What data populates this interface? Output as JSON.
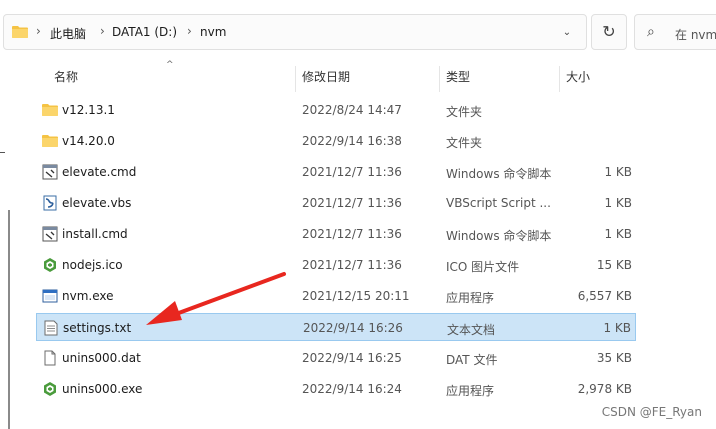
{
  "breadcrumb": [
    "此电脑",
    "DATA1 (D:)",
    "nvm"
  ],
  "search": {
    "placeholder": "在 nvm"
  },
  "columns": {
    "name": "名称",
    "date": "修改日期",
    "type": "类型",
    "size": "大小"
  },
  "files": [
    {
      "name": "v12.13.1",
      "date": "2022/8/24 14:47",
      "type": "文件夹",
      "size": "",
      "icon": "folder-icon"
    },
    {
      "name": "v14.20.0",
      "date": "2022/9/14 16:38",
      "type": "文件夹",
      "size": "",
      "icon": "folder-icon"
    },
    {
      "name": "elevate.cmd",
      "date": "2021/12/7 11:36",
      "type": "Windows 命令脚本",
      "size": "1 KB",
      "icon": "cmd-script-icon"
    },
    {
      "name": "elevate.vbs",
      "date": "2021/12/7 11:36",
      "type": "VBScript Script ...",
      "size": "1 KB",
      "icon": "vbs-script-icon"
    },
    {
      "name": "install.cmd",
      "date": "2021/12/7 11:36",
      "type": "Windows 命令脚本",
      "size": "1 KB",
      "icon": "cmd-script-icon"
    },
    {
      "name": "nodejs.ico",
      "date": "2021/12/7 11:36",
      "type": "ICO 图片文件",
      "size": "15 KB",
      "icon": "nodejs-icon"
    },
    {
      "name": "nvm.exe",
      "date": "2021/12/15 20:11",
      "type": "应用程序",
      "size": "6,557 KB",
      "icon": "exe-window-icon"
    },
    {
      "name": "settings.txt",
      "date": "2022/9/14 16:26",
      "type": "文本文档",
      "size": "1 KB",
      "icon": "text-document-icon",
      "selected": true
    },
    {
      "name": "unins000.dat",
      "date": "2022/9/14 16:25",
      "type": "DAT 文件",
      "size": "35 KB",
      "icon": "blank-file-icon"
    },
    {
      "name": "unins000.exe",
      "date": "2022/9/14 16:24",
      "type": "应用程序",
      "size": "2,978 KB",
      "icon": "nodejs-icon"
    }
  ],
  "watermark": "CSDN @FE_Ryan",
  "colors": {
    "selection": "#cce4f7",
    "selection_border": "#99c9ef",
    "folder": "#f5c344",
    "arrow": "#e8271f",
    "node_green": "#4a9b3c"
  }
}
